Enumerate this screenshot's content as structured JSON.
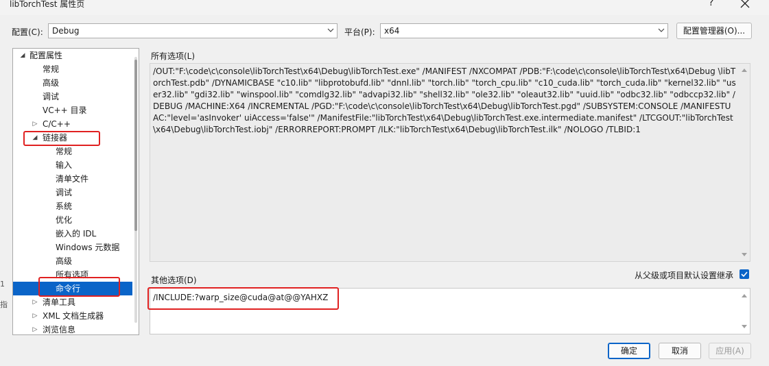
{
  "window": {
    "title": "libTorchTest 属性页",
    "help_glyph": "?",
    "close_label": "close"
  },
  "config": {
    "config_label": "配置(C):",
    "config_value": "Debug",
    "platform_label": "平台(P):",
    "platform_value": "x64",
    "manager_button": "配置管理器(O)..."
  },
  "tree": {
    "items": [
      {
        "label": "配置属性",
        "expander": "◢"
      },
      {
        "label": "常规",
        "expander": ""
      },
      {
        "label": "高级",
        "expander": ""
      },
      {
        "label": "调试",
        "expander": ""
      },
      {
        "label": "VC++ 目录",
        "expander": ""
      },
      {
        "label": "C/C++",
        "expander": "▷"
      },
      {
        "label": "链接器",
        "expander": "◢"
      },
      {
        "label": "常规",
        "expander": ""
      },
      {
        "label": "输入",
        "expander": ""
      },
      {
        "label": "清单文件",
        "expander": ""
      },
      {
        "label": "调试",
        "expander": ""
      },
      {
        "label": "系统",
        "expander": ""
      },
      {
        "label": "优化",
        "expander": ""
      },
      {
        "label": "嵌入的 IDL",
        "expander": ""
      },
      {
        "label": "Windows 元数据",
        "expander": ""
      },
      {
        "label": "高级",
        "expander": ""
      },
      {
        "label": "所有选项",
        "expander": ""
      },
      {
        "label": "命令行",
        "expander": "",
        "selected": true
      },
      {
        "label": "清单工具",
        "expander": "▷"
      },
      {
        "label": "XML 文档生成器",
        "expander": "▷"
      },
      {
        "label": "浏览信息",
        "expander": "▷"
      }
    ]
  },
  "all_options": {
    "label": "所有选项(L)",
    "text": "/OUT:\"F:\\code\\c\\console\\libTorchTest\\x64\\Debug\\libTorchTest.exe\" /MANIFEST /NXCOMPAT /PDB:\"F:\\code\\c\\console\\libTorchTest\\x64\\Debug \\libTorchTest.pdb\" /DYNAMICBASE \"c10.lib\" \"libprotobufd.lib\" \"dnnl.lib\" \"torch.lib\" \"torch_cpu.lib\" \"c10_cuda.lib\" \"torch_cuda.lib\" \"kernel32.lib\" \"user32.lib\" \"gdi32.lib\" \"winspool.lib\" \"comdlg32.lib\" \"advapi32.lib\" \"shell32.lib\" \"ole32.lib\" \"oleaut32.lib\" \"uuid.lib\" \"odbc32.lib\" \"odbccp32.lib\" /DEBUG /MACHINE:X64 /INCREMENTAL /PGD:\"F:\\code\\c\\console\\libTorchTest\\x64\\Debug\\libTorchTest.pgd\" /SUBSYSTEM:CONSOLE /MANIFESTUAC:\"level='asInvoker' uiAccess='false'\" /ManifestFile:\"libTorchTest\\x64\\Debug\\libTorchTest.exe.intermediate.manifest\" /LTCGOUT:\"libTorchTest\\x64\\Debug\\libTorchTest.iobj\" /ERRORREPORT:PROMPT /ILK:\"libTorchTest\\x64\\Debug\\libTorchTest.ilk\" /NOLOGO /TLBID:1"
  },
  "other_options": {
    "label": "其他选项(D)",
    "value": "/INCLUDE:?warp_size@cuda@at@@YAHXZ",
    "inherit_label": "从父级或项目默认设置继承",
    "inherit_checked": true
  },
  "footer": {
    "ok": "确定",
    "cancel": "取消",
    "apply": "应用(A)"
  },
  "colors": {
    "accent": "#0a64c8",
    "annotation_red": "#e02020"
  }
}
